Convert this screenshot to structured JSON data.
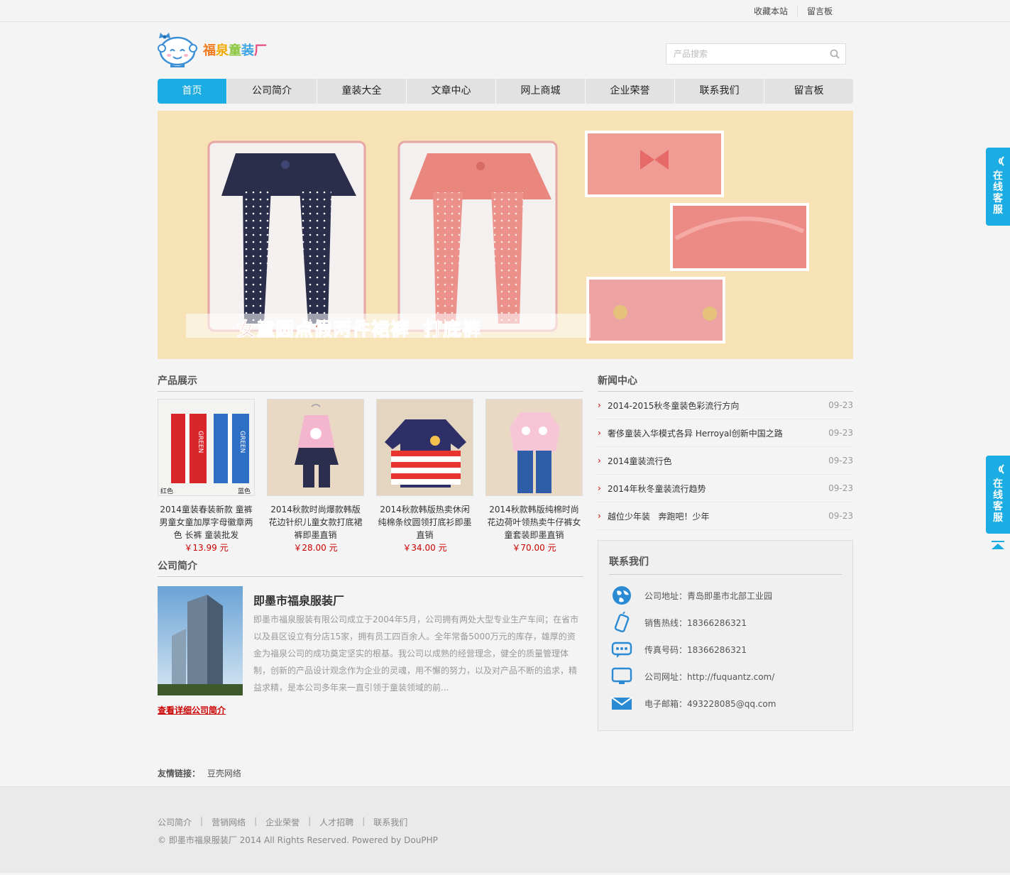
{
  "topbar": {
    "bookmark": "收藏本站",
    "guestbook": "留言板"
  },
  "logo": {
    "text_parts": [
      "福",
      "泉",
      "童",
      "装",
      "厂"
    ]
  },
  "search": {
    "placeholder": "产品搜索"
  },
  "nav": [
    "首页",
    "公司简介",
    "童装大全",
    "文章中心",
    "网上商城",
    "企业荣誉",
    "联系我们",
    "留言板"
  ],
  "banner": {
    "caption": "女童圆点假两件裙裤  打底裤"
  },
  "products": {
    "title": "产品展示",
    "items": [
      {
        "title": "2014童装春装新款 童裤男童女童加厚字母徽章两色 长裤 童装批发",
        "price": "￥13.99 元",
        "colors": [
          "红色",
          "蓝色"
        ],
        "print": "GREEN"
      },
      {
        "title": "2014秋款时尚爆款韩版花边针织儿童女款打底裙裤即墨直销",
        "price": "￥28.00 元"
      },
      {
        "title": "2014秋款韩版热卖休闲纯棉条纹圆领打底衫即墨直销",
        "price": "￥34.00 元"
      },
      {
        "title": "2014秋款韩版纯棉时尚花边荷叶领热卖牛仔裤女童套装即墨直销",
        "price": "￥70.00 元"
      }
    ]
  },
  "about": {
    "title": "公司简介",
    "name": "即墨市福泉服装厂",
    "text": "即墨市福泉服装有限公司成立于2004年5月，公司拥有两处大型专业生产车间；在省市以及县区设立有分店15家，拥有员工四百余人。全年常备5000万元的库存，雄厚的资金为福泉公司的成功奠定坚实的根基。我公司以成熟的经营理念，健全的质量管理体制，创新的产品设计观念作为企业的灵魂，用不懈的努力，以及对产品不断的追求，精益求精，是本公司多年来一直引领于童装领域的前...",
    "more": "查看详细公司简介"
  },
  "news": {
    "title": "新闻中心",
    "items": [
      {
        "title": "2014-2015秋冬童装色彩流行方向",
        "date": "09-23"
      },
      {
        "title": "奢侈童装入华模式各异 Herroyal创新中国之路",
        "date": "09-23"
      },
      {
        "title": "2014童装流行色",
        "date": "09-23"
      },
      {
        "title": "2014年秋冬童装流行趋势",
        "date": "09-23"
      },
      {
        "title": "越位少年装   奔跑吧！少年",
        "date": "09-23"
      }
    ]
  },
  "contact": {
    "title": "联系我们",
    "items": [
      {
        "icon": "globe-icon",
        "text": "公司地址：青岛即墨市北部工业园"
      },
      {
        "icon": "mobile-phone-icon",
        "text": "销售热线：18366286321"
      },
      {
        "icon": "chat-bubble-icon",
        "text": "传真号码：18366286321"
      },
      {
        "icon": "monitor-icon",
        "text": "公司网址：http://fuquantz.com/"
      },
      {
        "icon": "envelope-icon",
        "text": "电子邮箱：493228085@qq.com"
      }
    ]
  },
  "friend_links": {
    "label": "友情链接：",
    "items": [
      "豆壳网络"
    ]
  },
  "footer": {
    "nav": [
      "公司简介",
      "营销网络",
      "企业荣誉",
      "人才招聘",
      "联系我们"
    ],
    "copyright": "© 即墨市福泉服装厂 2014 All Rights Reserved. Powered by DouPHP"
  },
  "side": {
    "online_service": "在线客服"
  },
  "colors": {
    "accent": "#1aace3",
    "price": "#cc0000",
    "banner_bg": "#f7e2b6"
  }
}
